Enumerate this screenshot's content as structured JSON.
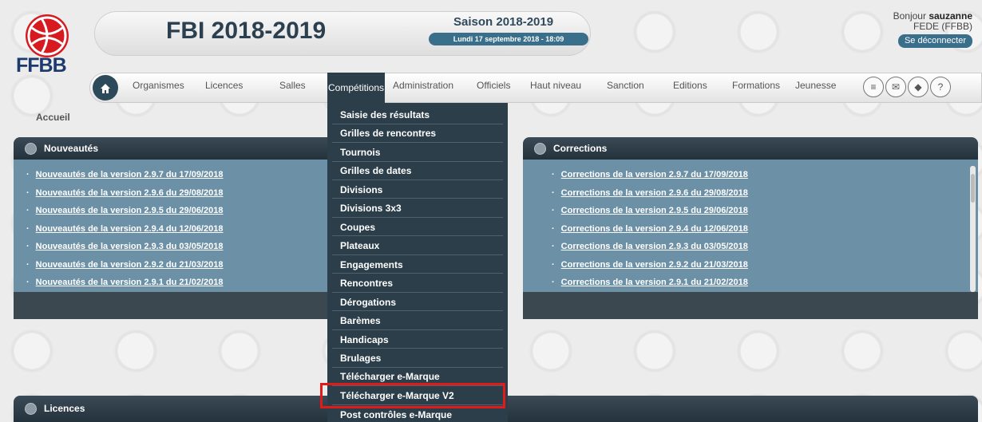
{
  "header": {
    "logo_text": "FFBB",
    "app_title": "FBI 2018-2019",
    "season": "Saison 2018-2019",
    "datetime": "Lundi 17 septembre 2018 - 18:09",
    "greeting": "Bonjour",
    "username": "sauzanne",
    "org": "FEDE (FFBB)",
    "logout_label": "Se déconnecter"
  },
  "nav": {
    "items": [
      "Organismes",
      "Licences",
      "Salles",
      "Compétitions",
      "Administration",
      "Officiels",
      "Haut niveau",
      "Sanction",
      "Editions",
      "Formations",
      "Jeunesse"
    ],
    "active": "Compétitions",
    "icons": [
      "list-icon",
      "mail-icon",
      "book-icon",
      "help-icon"
    ],
    "help_glyph": "?"
  },
  "breadcrumb": "Accueil",
  "competitions_menu": [
    "Saisie des résultats",
    "Grilles de rencontres",
    "Tournois",
    "Grilles de dates",
    "Divisions",
    "Divisions 3x3",
    "Coupes",
    "Plateaux",
    "Engagements",
    "Rencontres",
    "Dérogations",
    "Barèmes",
    "Handicaps",
    "Brulages",
    "Télécharger e-Marque",
    "Télécharger e-Marque V2",
    "Post contrôles e-Marque"
  ],
  "highlighted_item": "Télécharger e-Marque V2",
  "panels": {
    "nouveautes": {
      "title": "Nouveautés",
      "items": [
        "Nouveautés de la version 2.9.7 du 17/09/2018",
        "Nouveautés de la version 2.9.6 du 29/08/2018",
        "Nouveautés de la version 2.9.5 du 29/06/2018",
        "Nouveautés de la version 2.9.4 du 12/06/2018",
        "Nouveautés de la version 2.9.3 du 03/05/2018",
        "Nouveautés de la version 2.9.2 du 21/03/2018",
        "Nouveautés de la version 2.9.1 du 21/02/2018"
      ]
    },
    "corrections": {
      "title": "Corrections",
      "items": [
        "Corrections de la version 2.9.7 du 17/09/2018",
        "Corrections de la version 2.9.6 du 29/08/2018",
        "Corrections de la version 2.9.5 du 29/06/2018",
        "Corrections de la version 2.9.4 du 12/06/2018",
        "Corrections de la version 2.9.3 du 03/05/2018",
        "Corrections de la version 2.9.2 du 21/03/2018",
        "Corrections de la version 2.9.1 du 21/02/2018"
      ]
    },
    "licences": {
      "title": "Licences"
    }
  },
  "colors": {
    "accent": "#3a6f8c",
    "menu_bg": "#2b3e4a",
    "panel_body": "#6c90a6",
    "highlight_border": "#e11a1a",
    "brand_red": "#d71920"
  }
}
